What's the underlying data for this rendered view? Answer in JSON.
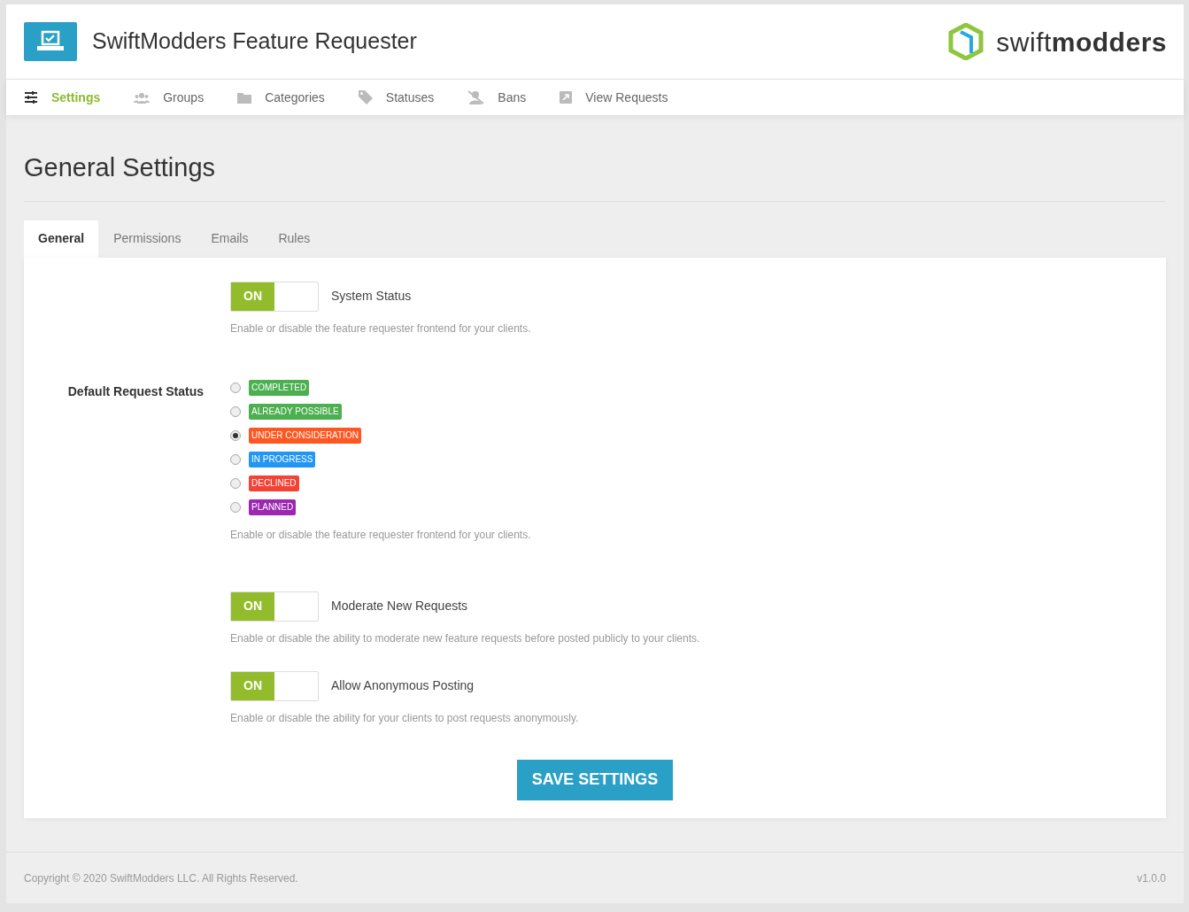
{
  "header": {
    "title": "SwiftModders Feature Requester",
    "brand": "swift**modders**"
  },
  "nav": [
    {
      "label": "Settings",
      "kind": "sliders",
      "selected": true
    },
    {
      "label": "Groups",
      "kind": "users",
      "selected": false
    },
    {
      "label": "Categories",
      "kind": "folder",
      "selected": false
    },
    {
      "label": "Statuses",
      "kind": "tag",
      "selected": false
    },
    {
      "label": "Bans",
      "kind": "ban",
      "selected": false
    },
    {
      "label": "View Requests",
      "kind": "external",
      "selected": false
    }
  ],
  "page_title": "General Settings",
  "tabs": [
    {
      "label": "General",
      "selected": true
    },
    {
      "label": "Permissions",
      "selected": false
    },
    {
      "label": "Emails",
      "selected": false
    },
    {
      "label": "Rules",
      "selected": false
    }
  ],
  "settings": [
    {
      "kind": "toggle",
      "toggle_text": "ON",
      "on": true,
      "label": "System Status",
      "description": "Enable or disable the feature requester frontend for your clients."
    },
    {
      "kind": "radio",
      "label": "Default Request Status",
      "options": [
        {
          "label": "COMPLETED",
          "color": "#4caf50",
          "selected": false
        },
        {
          "label": "ALREADY POSSIBLE",
          "color": "#4caf50",
          "selected": false
        },
        {
          "label": "UNDER CONSIDERATION",
          "color": "#ff5722",
          "selected": true
        },
        {
          "label": "IN PROGRESS",
          "color": "#2196f3",
          "selected": false
        },
        {
          "label": "DECLINED",
          "color": "#f44336",
          "selected": false
        },
        {
          "label": "PLANNED",
          "color": "#9c27b0",
          "selected": false
        }
      ],
      "description": "Enable or disable the feature requester frontend for your clients."
    },
    {
      "kind": "toggle",
      "toggle_text": "ON",
      "on": true,
      "label": "Moderate New Requests",
      "description": "Enable or disable the ability to moderate new feature requests before posted publicly to your clients."
    },
    {
      "kind": "toggle",
      "toggle_text": "ON",
      "on": true,
      "label": "Allow Anonymous Posting",
      "description": "Enable or disable the ability for your clients to post requests anonymously."
    }
  ],
  "save_button": "SAVE SETTINGS",
  "footer": {
    "copyright": "Copyright © 2020 SwiftModders LLC. All Rights Reserved.",
    "version": "v1.0.0"
  }
}
